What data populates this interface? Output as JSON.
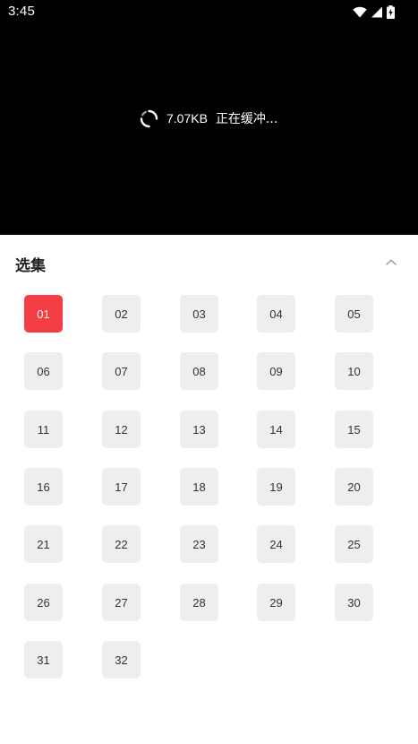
{
  "status_bar": {
    "time": "3:45",
    "icons": [
      "wifi-icon",
      "signal-icon",
      "battery-charging-icon"
    ]
  },
  "player": {
    "speed": "7.07KB",
    "buffering_text": "正在缓冲..."
  },
  "episodes": {
    "title": "选集",
    "active_episode": "01",
    "accent_color": "#f33e46",
    "items": [
      "01",
      "02",
      "03",
      "04",
      "05",
      "06",
      "07",
      "08",
      "09",
      "10",
      "11",
      "12",
      "13",
      "14",
      "15",
      "16",
      "17",
      "18",
      "19",
      "20",
      "21",
      "22",
      "23",
      "24",
      "25",
      "26",
      "27",
      "28",
      "29",
      "30",
      "31",
      "32"
    ]
  }
}
